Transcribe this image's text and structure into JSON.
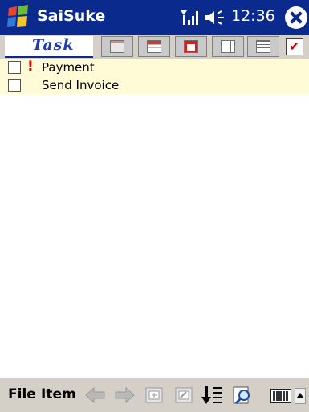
{
  "titlebar": {
    "app_title": "SaiSuke",
    "clock": "12:36",
    "icons": [
      "windows-start-logo",
      "signal-icon",
      "volume-icon",
      "close-icon"
    ]
  },
  "viewbar": {
    "task_tab_label": "Task",
    "view_buttons": [
      "month-view-icon",
      "week-view-icon",
      "day-view-icon",
      "multi-week-view-icon",
      "list-view-icon"
    ],
    "task_view_checked": true
  },
  "tasks": [
    {
      "label": "Payment",
      "checked": false,
      "high_priority": true
    },
    {
      "label": "Send Invoice",
      "checked": false,
      "high_priority": false
    }
  ],
  "menubar": {
    "file_label": "File",
    "item_label": "Item",
    "tools": [
      "back-arrow-icon",
      "forward-arrow-icon",
      "new-document-icon",
      "edit-document-icon",
      "sort-icon",
      "find-icon",
      "keyboard-icon",
      "input-panel-up-icon"
    ]
  },
  "colors": {
    "titlebar": "#0a2a8e",
    "toolbar": "#d4d0c8",
    "task_list_bg": "#fffbd6",
    "priority": "#e00000"
  }
}
